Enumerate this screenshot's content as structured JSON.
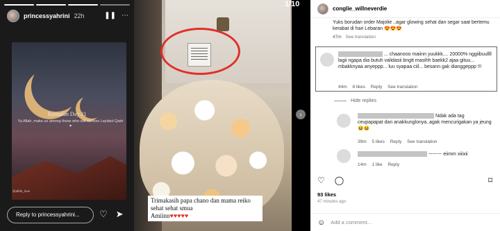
{
  "story": {
    "username": "princessyahrini",
    "time_ago": "22h",
    "title_line": "Ramadan Day 21",
    "caption": "Ya Allah, make us among those who will witness Laylatul Qadr",
    "credit": "@aflah_love",
    "reply_placeholder": "Reply to princessyahrini..."
  },
  "post": {
    "counter": "1/10",
    "overlay_text_1": "Trimakasih papa chano dan mama reiko sehat sehat smua",
    "overlay_text_2": "Amiinn",
    "overlay_hearts": "♥♥♥♥♥"
  },
  "comments_panel": {
    "username": "conglie_willneverdie",
    "caption": "Yuks borudan order Majolie ..agar glowing sehat dan segar saat bertemu kerabat di hari Lebaran 😍😍😍",
    "caption_ago": "47m",
    "caption_link": "See translation",
    "highlighted": {
      "text_1": "... chaanooo maiinn yuukkk.... 20000% nggiibuullll lagii ngapa dia butuh validasii bngtt masihh baekk2 ajaa gituu... mbakknyaa anyeppp... luu syapaa ciil... besann gak dianggeppp !!!",
      "ago": "44m",
      "likes": "8 likes",
      "reply": "Reply",
      "translate": "See translation"
    },
    "hide_replies": "Hide replies",
    "reply_1": {
      "text_1": "Ndak ada tag",
      "text_2": "ceupapapat dan anakkunglonya..agak mencurigakan ya jeung 😆😆",
      "ago": "39m",
      "likes": "5 likes",
      "reply": "Reply",
      "translate": "See translation"
    },
    "reply_2": {
      "text": "ᅳᅳᅳ eiimm xiiixii",
      "ago": "14m",
      "likes": "1 like",
      "reply": "Reply"
    },
    "likes_total": "93 likes",
    "post_ago": "47 minutes ago",
    "add_comment_placeholder": "Add a comment..."
  }
}
